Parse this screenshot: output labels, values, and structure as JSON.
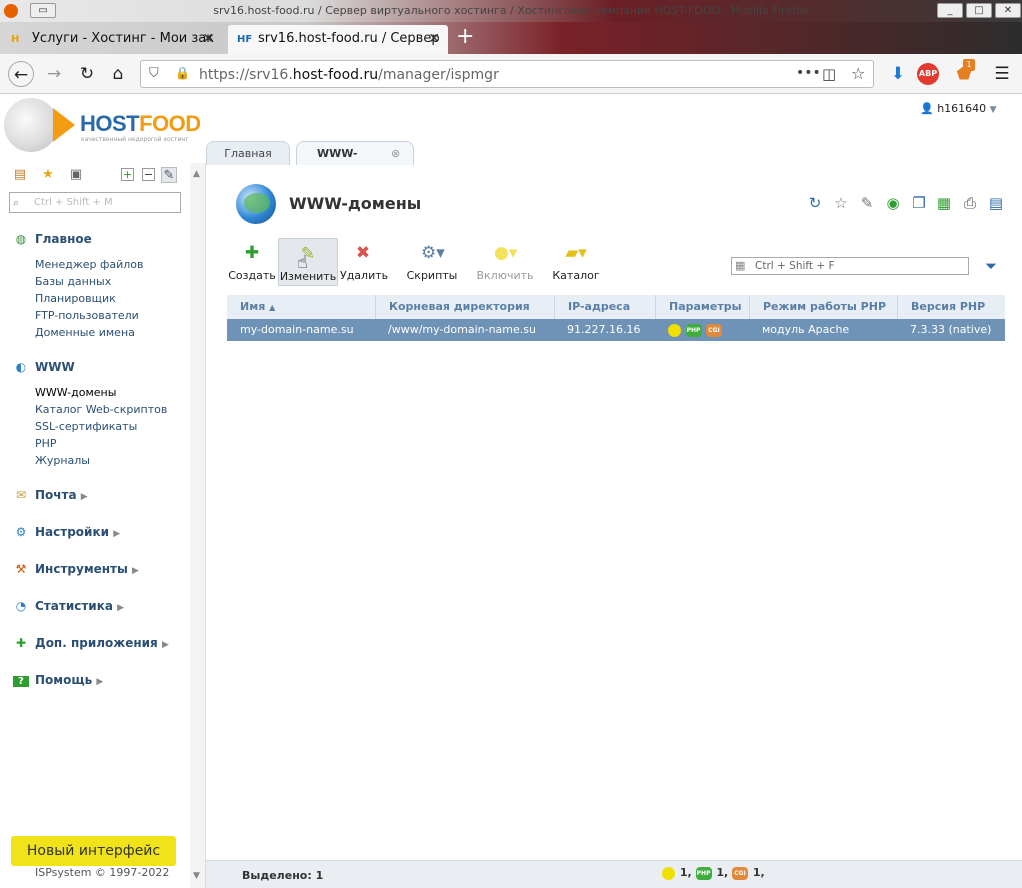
{
  "window": {
    "title": "srv16.host-food.ru / Сервер виртуального хостинга / Хостинговая компания HOST-FOOD - Mozilla Firefox"
  },
  "browser": {
    "tabs": [
      {
        "icon": "H",
        "label": "Услуги - Хостинг - Мои зак"
      },
      {
        "icon": "HF",
        "label": "srv16.host-food.ru / Сервер"
      }
    ],
    "url": {
      "prefix": "https://srv16.",
      "domain": "host-food.ru",
      "suffix": "/manager/ispmgr"
    },
    "badge_count": "1",
    "abp_label": "ABP"
  },
  "app": {
    "logo": {
      "part1": "HOST",
      "part2": "FOOD",
      "tagline": "качественный недорогой хостинг"
    },
    "user": "h161640",
    "page_tabs": [
      "Главная",
      "WWW-домены"
    ],
    "sidebar": {
      "search_placeholder": "Ctrl + Shift + M",
      "groups": [
        {
          "label": "Главное",
          "items": [
            "Менеджер файлов",
            "Базы данных",
            "Планировщик",
            "FTP-пользователи",
            "Доменные имена"
          ]
        },
        {
          "label": "WWW",
          "items": [
            "WWW-домены",
            "Каталог Web-скриптов",
            "SSL-сертификаты",
            "PHP",
            "Журналы"
          ]
        },
        {
          "label": "Почта",
          "items": []
        },
        {
          "label": "Настройки",
          "items": []
        },
        {
          "label": "Инструменты",
          "items": []
        },
        {
          "label": "Статистика",
          "items": []
        },
        {
          "label": "Доп. приложения",
          "items": []
        },
        {
          "label": "Помощь",
          "items": []
        }
      ],
      "new_interface": "Новый интерфейс",
      "copyright": "ISPsystem © 1997-2022"
    },
    "page_title": "WWW-домены",
    "toolbar": [
      "Создать",
      "Изменить",
      "Удалить",
      "Скрипты",
      "Включить",
      "Каталог"
    ],
    "filter_placeholder": "Ctrl + Shift + F",
    "table": {
      "columns": [
        "Имя",
        "Корневая директория",
        "IP-адреса",
        "Параметры",
        "Режим работы PHP",
        "Версия PHP"
      ],
      "rows": [
        {
          "name": "my-domain-name.su",
          "root": "/www/my-domain-name.su",
          "ip": "91.227.16.16",
          "params": [
            "PHP",
            "CGI"
          ],
          "php_mode": "модуль Apache",
          "php_version": "7.3.33 (native)"
        }
      ]
    },
    "status": {
      "selected_label": "Выделено:",
      "selected_count": "1",
      "counts": [
        "1,",
        "1,",
        "1,"
      ],
      "badges": [
        "PHP",
        "CGI"
      ]
    }
  }
}
